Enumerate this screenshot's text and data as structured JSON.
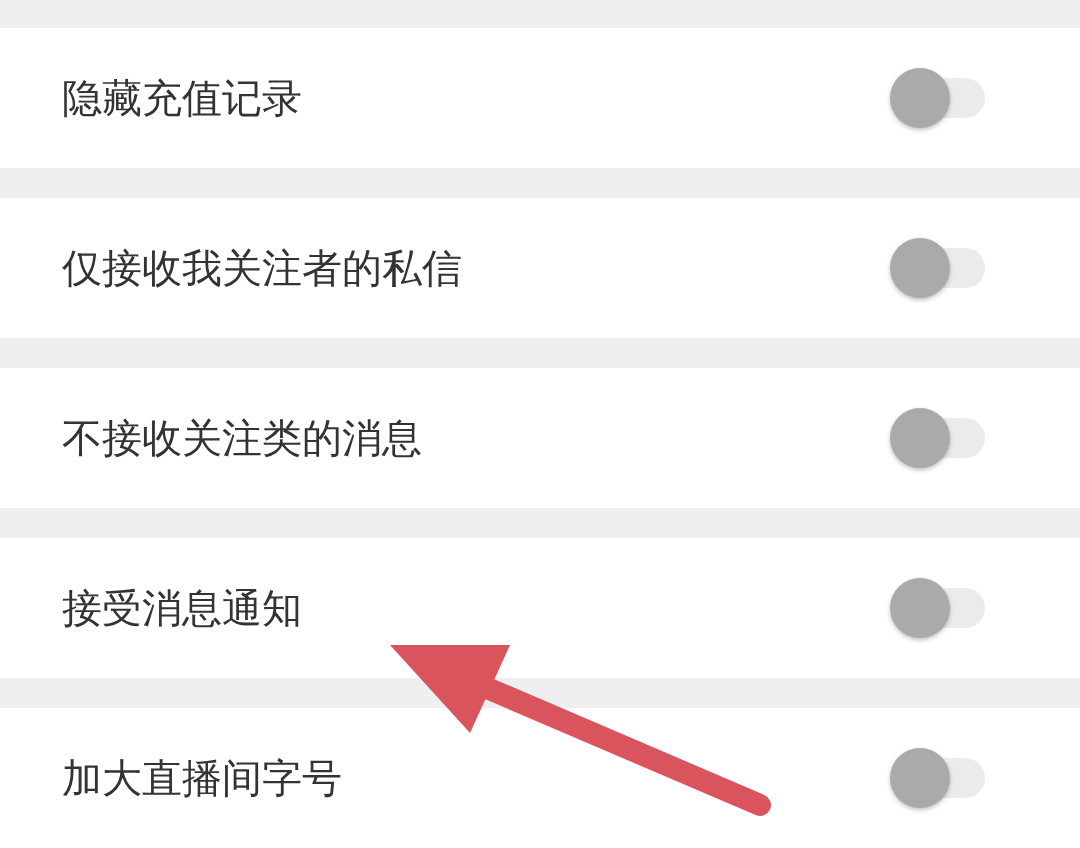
{
  "settings": [
    {
      "label": "隐藏充值记录",
      "on": false
    },
    {
      "label": "仅接收我关注者的私信",
      "on": false
    },
    {
      "label": "不接收关注类的消息",
      "on": false
    },
    {
      "label": "接受消息通知",
      "on": false
    },
    {
      "label": "加大直播间字号",
      "on": false
    }
  ]
}
